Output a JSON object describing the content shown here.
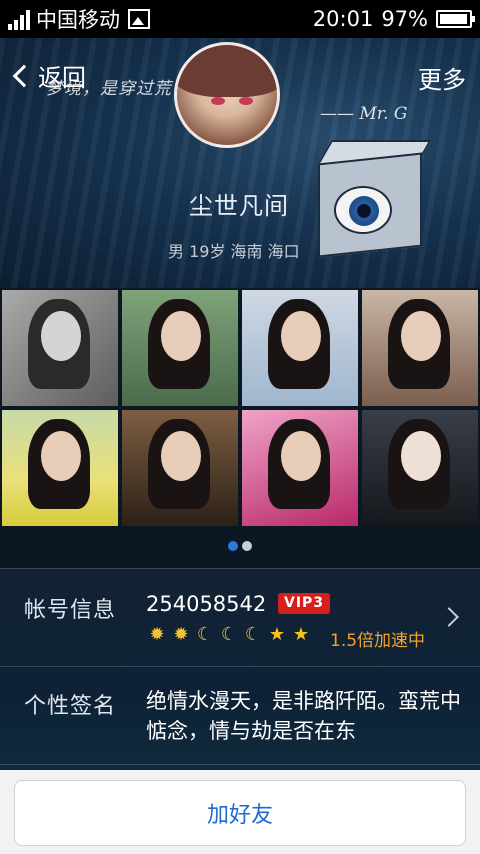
{
  "status_bar": {
    "carrier": "中国移动",
    "time": "20:01",
    "battery": "97%",
    "battery_level": 0.97
  },
  "nav": {
    "back_label": "返回",
    "more_label": "更多"
  },
  "cover": {
    "quote_text": "梦境，是穿过荒 弘清泉。",
    "quote_author": "—— Mr. G"
  },
  "profile": {
    "nickname": "尘世凡间",
    "basic_info": "男 19岁 海南 海口"
  },
  "photos": {
    "count": 8,
    "pages": 2,
    "active_page": 1
  },
  "account": {
    "label": "帐号信息",
    "qq_number": "254058542",
    "vip": "VIP3",
    "level_icons": [
      "sun",
      "sun",
      "moon",
      "moon",
      "moon",
      "star",
      "star"
    ],
    "speed_text": "1.5倍加速中"
  },
  "signature": {
    "label": "个性签名",
    "text": "绝情水漫天，是非路阡陌。蛮荒中惦念，情与劫是否在东"
  },
  "actions": {
    "add_friend_label": "加好友"
  },
  "colors": {
    "accent": "#1f6ad1",
    "vip_red": "#d6201b",
    "speed_orange": "#f3a32a"
  }
}
